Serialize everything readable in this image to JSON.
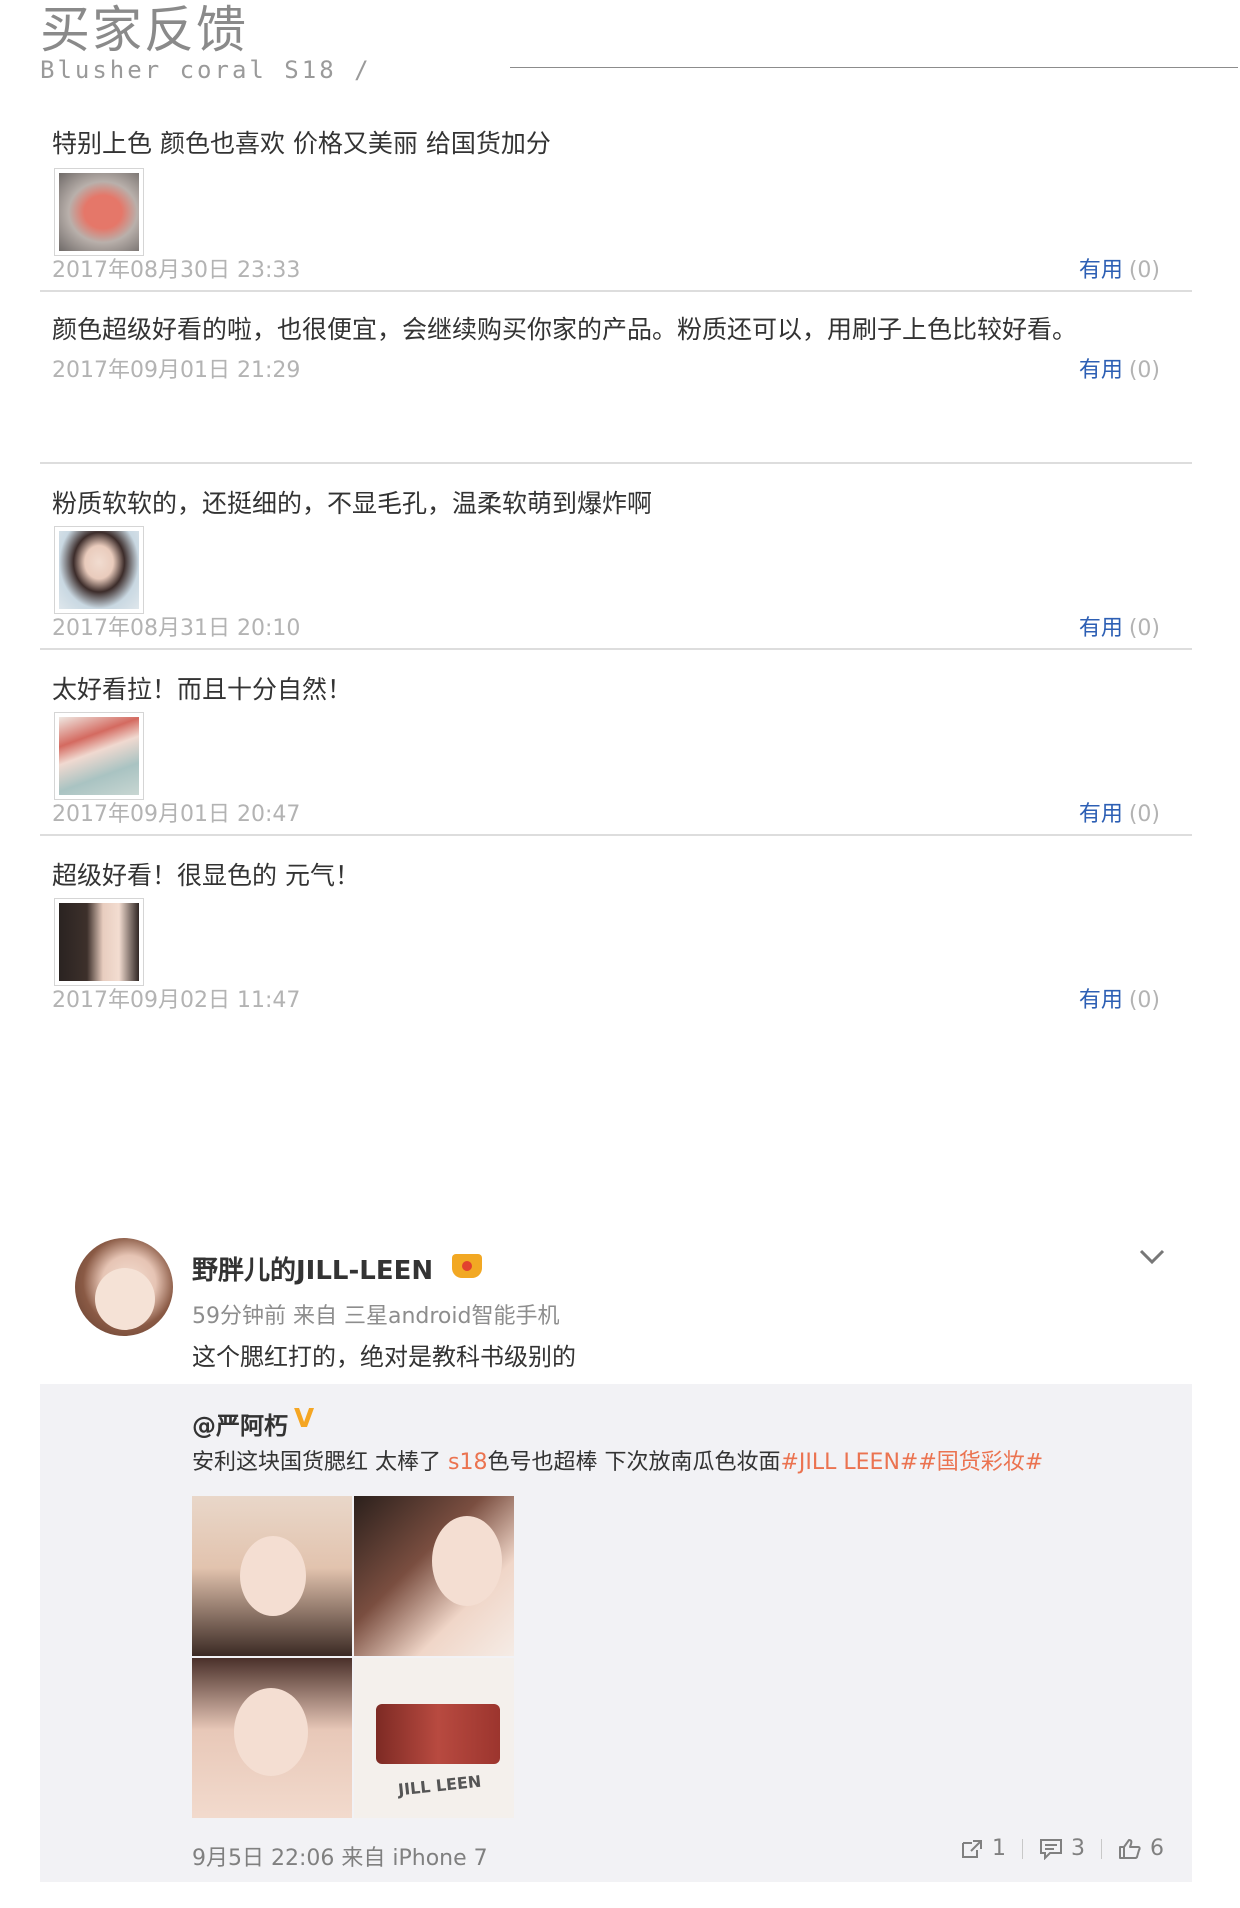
{
  "header": {
    "title": "买家反馈",
    "subtitle": "Blusher coral S18 /"
  },
  "reviews": [
    {
      "text": "特别上色 颜色也喜欢 价格又美丽 给国货加分",
      "has_image": true,
      "date": "2017年08月30日 23:33",
      "useful_label": "有用",
      "useful_count": "(0)"
    },
    {
      "text": "颜色超级好看的啦，也很便宜，会继续购买你家的产品。粉质还可以，用刷子上色比较好看。",
      "has_image": false,
      "date": "2017年09月01日 21:29",
      "useful_label": "有用",
      "useful_count": "(0)"
    },
    {
      "text": "粉质软软的，还挺细的，不显毛孔，温柔软萌到爆炸啊",
      "has_image": true,
      "date": "2017年08月31日 20:10",
      "useful_label": "有用",
      "useful_count": "(0)"
    },
    {
      "text": "太好看拉！而且十分自然！",
      "has_image": true,
      "date": "2017年09月01日 20:47",
      "useful_label": "有用",
      "useful_count": "(0)"
    },
    {
      "text": "超级好看！很显色的 元气！",
      "has_image": true,
      "date": "2017年09月02日 11:47",
      "useful_label": "有用",
      "useful_count": "(0)"
    }
  ],
  "weibo": {
    "username": "野胖儿的JILL-LEEN",
    "meta": "59分钟前 来自 三星android智能手机",
    "text": "这个腮红打的，绝对是教科书级别的",
    "repost": {
      "author": "@严阿朽",
      "verified_mark": "V",
      "text_part1": "安利这块国货腮红 太棒了 ",
      "text_highlight1": "s18",
      "text_part2": "色号也超棒 下次放南瓜色妆面",
      "text_highlight2": "#JILL LEEN##国货彩妆#",
      "photo_brand": "JILL LEEN",
      "footer": "9月5日 22:06 来自 iPhone 7",
      "repost_count": "1",
      "comment_count": "3",
      "like_count": "6"
    }
  },
  "colors": {
    "link_blue": "#2d5fb4",
    "highlight_orange": "#eb7350",
    "verified_gold": "#f5a623"
  }
}
